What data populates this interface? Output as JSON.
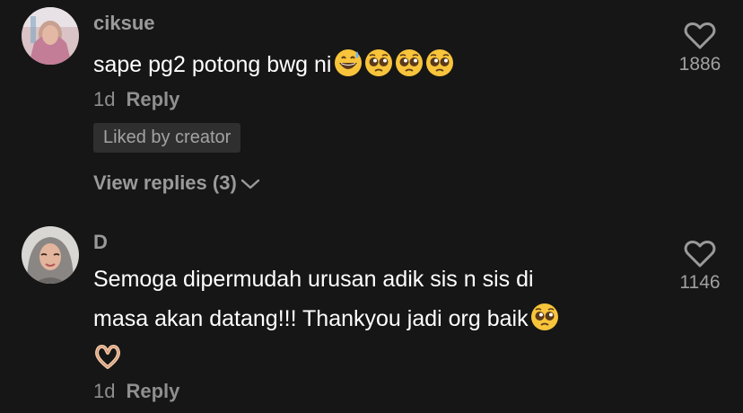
{
  "comments": [
    {
      "username": "ciksue",
      "text": "sape pg2 potong bwg ni",
      "emojis": [
        "grinning-sweat-emoji",
        "pleading-face-emoji",
        "pleading-face-emoji",
        "pleading-face-emoji"
      ],
      "time": "1d",
      "reply_label": "Reply",
      "badge": "Liked by creator",
      "view_replies": "View replies (3)",
      "like_count": "1886"
    },
    {
      "username": "D",
      "text_line1": "Semoga dipermudah urusan adik sis n sis di",
      "text_line2": "masa akan datang!!! Thankyou jadi org baik",
      "emojis": [
        "pleading-face-emoji",
        "heart-hands-emoji"
      ],
      "time": "1d",
      "reply_label": "Reply",
      "like_count": "1146"
    }
  ],
  "colors": {
    "background": "#161616",
    "text_primary": "#ffffff",
    "text_secondary": "#9a9a9a",
    "badge_bg": "#2f2f2f",
    "emoji_yellow": "#f7c43b"
  }
}
